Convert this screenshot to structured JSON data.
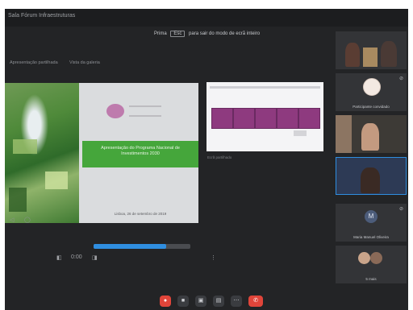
{
  "window": {
    "title": "Sala Fórum Infraestruturas"
  },
  "notice": {
    "prefix": "Prima",
    "key": "Esc",
    "suffix": "para sair do modo de ecrã inteiro"
  },
  "tabs": [
    {
      "label": "Apresentação partilhada"
    },
    {
      "label": "Vista da galeria"
    }
  ],
  "slide": {
    "headline": "Apresentação do Programa Nacional de Investimentos 2030",
    "footer": "Lisboa, 26 de setembro de 2019"
  },
  "secondary_share": {
    "label": "Ecrã partilhado"
  },
  "player": {
    "progress": 0.75,
    "time": "0:00"
  },
  "participants": [
    {
      "name": "",
      "kind": "video"
    },
    {
      "name": "Participante convidado",
      "kind": "avatar"
    },
    {
      "name": "",
      "kind": "video"
    },
    {
      "name": "",
      "kind": "video-active"
    },
    {
      "name": "Maria Manuel Oliveira",
      "initial": "M",
      "kind": "initial"
    },
    {
      "name": "5 mais",
      "kind": "group"
    }
  ],
  "controls": [
    {
      "icon": "mic-icon",
      "glyph": "●"
    },
    {
      "icon": "camera-icon",
      "glyph": "■"
    },
    {
      "icon": "share-screen-icon",
      "glyph": "▣"
    },
    {
      "icon": "chat-icon",
      "glyph": "▤"
    },
    {
      "icon": "more-icon",
      "glyph": "⋯"
    },
    {
      "icon": "hangup-icon",
      "glyph": "✆"
    }
  ],
  "colors": {
    "accent": "#2f8ee0",
    "hangup": "#e0453a",
    "slide_green": "#45a63b",
    "slide_purple": "#8e3a7f"
  }
}
